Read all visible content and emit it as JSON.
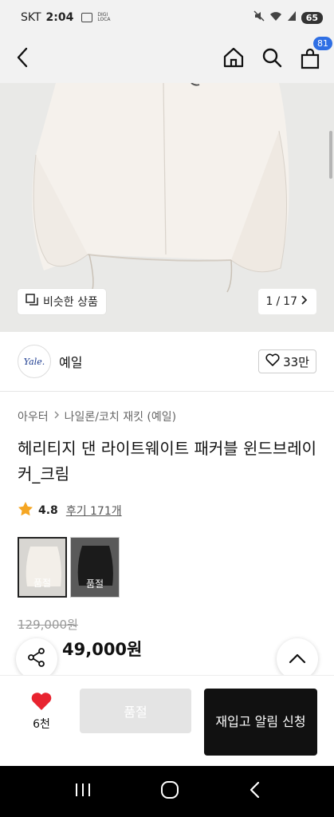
{
  "status_bar": {
    "carrier": "SKT",
    "time": "2:04",
    "mini_label": "DIGI LOCA",
    "battery": "65"
  },
  "nav": {
    "cart_count": "81"
  },
  "gallery": {
    "similar_label": "비슷한 상품",
    "page_current": "1",
    "page_total": "17",
    "page_separator": "/"
  },
  "brand": {
    "logo_text": "Yale.",
    "name": "예일",
    "likes": "33만"
  },
  "product": {
    "category": [
      "아우터",
      "나일론/코치 재킷 (예일)"
    ],
    "title": "헤리티지 댄 라이트웨이트 패커블 윈드브레이커_크림",
    "rating": "4.8",
    "reviews": "후기 171개",
    "options": [
      {
        "status": "품절",
        "tone": "light",
        "selected": true
      },
      {
        "status": "품절",
        "tone": "dark",
        "selected": false
      }
    ],
    "original_price": "129,000원",
    "sale_price": "49,000원"
  },
  "actions": {
    "wish_count": "6천",
    "soldout_label": "품절",
    "restock_label": "재입고 알림 신청"
  },
  "colors": {
    "accent_blue": "#2f6fe4",
    "discount_red": "#e53b2c",
    "star": "#f5a623",
    "heart": "#e8232f"
  }
}
